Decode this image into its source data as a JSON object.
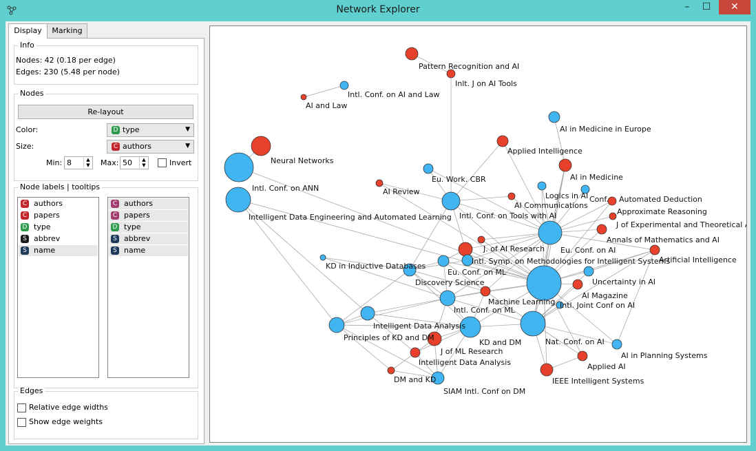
{
  "window": {
    "title": "Network Explorer",
    "app_icon": "network-explorer-icon",
    "controls": {
      "minimize": "–",
      "maximize": "☐",
      "close": "✕"
    }
  },
  "tabs": [
    {
      "label": "Display",
      "active": true
    },
    {
      "label": "Marking",
      "active": false
    }
  ],
  "info": {
    "title": "Info",
    "nodes_line": "Nodes: 42 (0.18 per edge)",
    "edges_line": "Edges: 230 (5.48 per node)"
  },
  "nodes_section": {
    "title": "Nodes",
    "relayout_label": "Re-layout",
    "color_label": "Color:",
    "color_value": {
      "badge": "D",
      "text": "type",
      "badge_color": "#2e9a4c"
    },
    "size_label": "Size:",
    "size_value": {
      "badge": "C",
      "text": "authors",
      "badge_color": "#c1272d"
    },
    "min_label": "Min:",
    "min_value": "8",
    "max_label": "Max:",
    "max_value": "50",
    "invert_label": "Invert",
    "invert_checked": false
  },
  "labels_section": {
    "title": "Node labels | tooltips",
    "labels_list": [
      {
        "badge": "C",
        "text": "authors",
        "color": "#c1272d"
      },
      {
        "badge": "C",
        "text": "papers",
        "color": "#c1272d"
      },
      {
        "badge": "D",
        "text": "type",
        "color": "#2e9a4c"
      },
      {
        "badge": "S",
        "text": "abbrev",
        "color": "#1a1a1a"
      },
      {
        "badge": "S",
        "text": "name",
        "color": "#1d3a5c"
      }
    ],
    "tooltips_list": [
      {
        "badge": "C",
        "text": "authors",
        "color": "#a23c6e"
      },
      {
        "badge": "C",
        "text": "papers",
        "color": "#a23c6e"
      },
      {
        "badge": "D",
        "text": "type",
        "color": "#2e9a4c"
      },
      {
        "badge": "S",
        "text": "abbrev",
        "color": "#1d3a5c"
      },
      {
        "badge": "S",
        "text": "name",
        "color": "#1d3a5c"
      }
    ]
  },
  "edges_section": {
    "title": "Edges",
    "relative_widths_label": "Relative edge widths",
    "show_weights_label": "Show edge weights"
  },
  "colors": {
    "journal": "#e8412b",
    "conference": "#40b5f2",
    "edge": "#a9a9a9"
  },
  "graph": {
    "nodes": [
      {
        "id": "pr_ai",
        "label": "Pattern Recognition and AI",
        "type": "journal",
        "authors": 4
      },
      {
        "id": "inlt_j_ai_tools",
        "label": "Inlt. J on AI Tools",
        "type": "journal",
        "authors": 3
      },
      {
        "id": "intl_conf_ai_law",
        "label": "Intl. Conf. on AI and Law",
        "type": "conference",
        "authors": 3
      },
      {
        "id": "ai_law",
        "label": "AI and Law",
        "type": "journal",
        "authors": 2
      },
      {
        "id": "ai_med_europe",
        "label": "AI in Medicine in Europe",
        "type": "conference",
        "authors": 4
      },
      {
        "id": "applied_intel",
        "label": "Applied Intelligence",
        "type": "journal",
        "authors": 4
      },
      {
        "id": "neural_networks",
        "label": "Neural Networks",
        "type": "journal",
        "authors": 6
      },
      {
        "id": "ai_in_medicine",
        "label": "AI in Medicine",
        "type": "journal",
        "authors": 4
      },
      {
        "id": "intl_conf_ann",
        "label": "Intl. Conf. on ANN",
        "type": "conference",
        "authors": 9
      },
      {
        "id": "eu_work_cbr",
        "label": "Eu. Work. CBR",
        "type": "conference",
        "authors": 3
      },
      {
        "id": "ai_review",
        "label": "AI Review",
        "type": "journal",
        "authors": 2
      },
      {
        "id": "logics_ai",
        "label": "Logics in AI",
        "type": "conference",
        "authors": 3
      },
      {
        "id": "conf_ad",
        "label": "Conf.",
        "type": "conference",
        "authors": 3
      },
      {
        "id": "automated_deduction",
        "label": "Automated Deduction",
        "type": "journal",
        "authors": 3
      },
      {
        "id": "ai_comm",
        "label": "AI Communications",
        "type": "journal",
        "authors": 2
      },
      {
        "id": "approx_reasoning",
        "label": "Approximate Reasoning",
        "type": "journal",
        "authors": 2
      },
      {
        "id": "ided_al",
        "label": "Intelligent Data Engineering and Automated Learning",
        "type": "conference",
        "authors": 8
      },
      {
        "id": "intl_conf_tools_ai",
        "label": "Intl. Conf. on Tools with AI",
        "type": "conference",
        "authors": 6
      },
      {
        "id": "j_exp_theo_ai",
        "label": "J of Experimental and Theoretical AI",
        "type": "journal",
        "authors": 3
      },
      {
        "id": "eu_conf_ai",
        "label": "Eu. Conf. on AI",
        "type": "conference",
        "authors": 8
      },
      {
        "id": "annals_math_ai",
        "label": "Annals of Mathematics and AI",
        "type": "journal",
        "authors": 2
      },
      {
        "id": "j_ai_research",
        "label": "J. of AI Research",
        "type": "journal",
        "authors": 2
      },
      {
        "id": "intl_symp_meth",
        "label": "Intl. Symp. on Methodologies for Intelligent Systems",
        "type": "conference",
        "authors": 4
      },
      {
        "id": "artificial_intel",
        "label": "Artificial Intelligence",
        "type": "journal",
        "authors": 3
      },
      {
        "id": "kd_inductive_db",
        "label": "KD in Inductive Databases",
        "type": "conference",
        "authors": 2
      },
      {
        "id": "eu_conf_ml",
        "label": "Eu. Conf. on ML",
        "type": "conference",
        "authors": 3
      },
      {
        "id": "discovery_science",
        "label": "Discovery Science",
        "type": "conference",
        "authors": 4
      },
      {
        "id": "big_conf_ai",
        "label": "",
        "type": "conference",
        "authors": 10
      },
      {
        "id": "uncertainty_ai",
        "label": "Uncertainty in AI",
        "type": "conference",
        "authors": 3
      },
      {
        "id": "ai_magazine",
        "label": "AI Magazine",
        "type": "journal",
        "authors": 3
      },
      {
        "id": "machine_learning",
        "label": "Machine Learning",
        "type": "journal",
        "authors": 3
      },
      {
        "id": "intl_joint_conf_ai",
        "label": "Intl. Joint Conf on AI",
        "type": "conference",
        "authors": 7
      },
      {
        "id": "intl_conf_ml",
        "label": "Intl. Conf. on ML",
        "type": "conference",
        "authors": 5
      },
      {
        "id": "ida_conf",
        "label": "Intelligent Data Analysis",
        "type": "conference",
        "authors": 4
      },
      {
        "id": "principles_kd_dm",
        "label": "Principles of KD and DM",
        "type": "conference",
        "authors": 5
      },
      {
        "id": "kd_dm",
        "label": "KD and DM",
        "type": "conference",
        "authors": 6
      },
      {
        "id": "j_ml_research",
        "label": "J of ML Research",
        "type": "journal",
        "authors": 4
      },
      {
        "id": "nat_conf_ai",
        "label": "Nat. Conf. on AI",
        "type": "conference",
        "authors": 7
      },
      {
        "id": "ai_planning",
        "label": "AI in Planning Systems",
        "type": "conference",
        "authors": 3
      },
      {
        "id": "applied_ai",
        "label": "Applied AI",
        "type": "journal",
        "authors": 3
      },
      {
        "id": "ida_journal",
        "label": "Intelligent Data Analysis",
        "type": "journal",
        "authors": 3
      },
      {
        "id": "dm_kd",
        "label": "DM and KD",
        "type": "journal",
        "authors": 2
      },
      {
        "id": "siam_dm",
        "label": "SIAM Intl. Conf on DM",
        "type": "conference",
        "authors": 4
      },
      {
        "id": "ieee_intel_sys",
        "label": "IEEE Intelligent Systems",
        "type": "journal",
        "authors": 4
      }
    ]
  }
}
